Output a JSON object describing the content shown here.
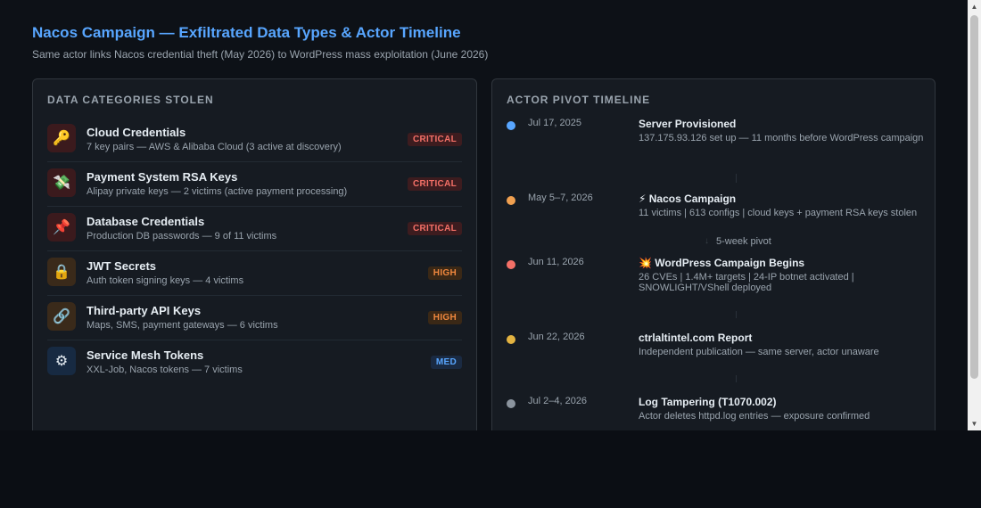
{
  "header": {
    "title": "Nacos Campaign — Exfiltrated Data Types & Actor Timeline",
    "subtitle": "Same actor links Nacos credential theft (May 2026) to WordPress mass exploitation (June 2026)"
  },
  "left_panel": {
    "heading": "DATA CATEGORIES STOLEN",
    "items": [
      {
        "icon": "key-icon",
        "glyph": "🔑",
        "title": "Cloud Credentials",
        "desc": "7 key pairs — AWS & Alibaba Cloud (3 active at discovery)",
        "badge": "CRITICAL",
        "severity": "critical"
      },
      {
        "icon": "money-wings-icon",
        "glyph": "💸",
        "title": "Payment System RSA Keys",
        "desc": "Alipay private keys — 2 victims (active payment processing)",
        "badge": "CRITICAL",
        "severity": "critical"
      },
      {
        "icon": "pushpin-icon",
        "glyph": "📌",
        "title": "Database Credentials",
        "desc": "Production DB passwords — 9 of 11 victims",
        "badge": "CRITICAL",
        "severity": "critical"
      },
      {
        "icon": "lock-icon",
        "glyph": "🔒",
        "title": "JWT Secrets",
        "desc": "Auth token signing keys — 4 victims",
        "badge": "HIGH",
        "severity": "high"
      },
      {
        "icon": "link-icon",
        "glyph": "🔗",
        "title": "Third-party API Keys",
        "desc": "Maps, SMS, payment gateways — 6 victims",
        "badge": "HIGH",
        "severity": "high"
      },
      {
        "icon": "gear-icon",
        "glyph": "⚙",
        "title": "Service Mesh Tokens",
        "desc": "XXL-Job, Nacos tokens — 7 victims",
        "badge": "MED",
        "severity": "med"
      }
    ]
  },
  "right_panel": {
    "heading": "ACTOR PIVOT TIMELINE",
    "pivot_label": "5-week pivot",
    "events": [
      {
        "date": "Jul 17, 2025",
        "title": "Server Provisioned",
        "desc": "137.175.93.126 set up — 11 months before WordPress campaign",
        "color": "#58a6ff"
      },
      {
        "date": "May 5–7, 2026",
        "title": "⚡ Nacos Campaign",
        "desc": "11 victims | 613 configs | cloud keys + payment RSA keys stolen",
        "color": "#f0a050"
      },
      {
        "date": "Jun 11, 2026",
        "title": "💥 WordPress Campaign Begins",
        "desc": "26 CVEs | 1.4M+ targets | 24-IP botnet activated | SNOWLIGHT/VShell deployed",
        "color": "#f47067"
      },
      {
        "date": "Jun 22, 2026",
        "title": "ctrlaltintel.com Report",
        "desc": "Independent publication — same server, actor unaware",
        "color": "#e3b341"
      },
      {
        "date": "Jul 2–4, 2026",
        "title": "Log Tampering (T1070.002)",
        "desc": "Actor deletes httpd.log entries — exposure confirmed",
        "color": "#8b949e"
      }
    ]
  },
  "colors": {
    "accent": "#58a6ff",
    "critical": "#f47067",
    "high": "#f0883e",
    "med": "#58a6ff",
    "background": "#0d1117",
    "panel": "#161b22"
  }
}
